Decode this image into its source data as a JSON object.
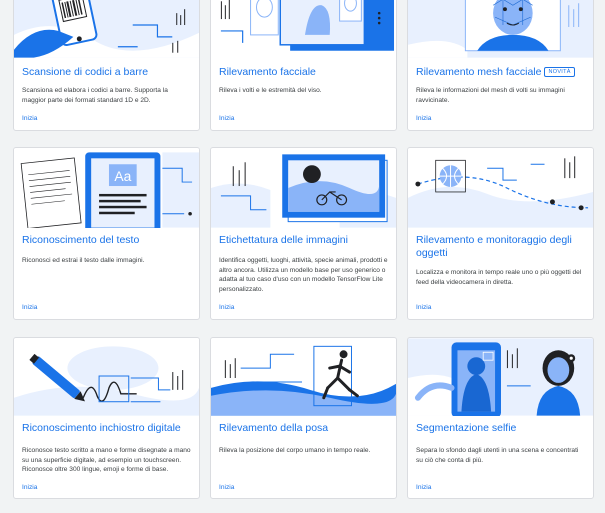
{
  "cards": [
    {
      "title": "Scansione di codici a barre",
      "badge": "",
      "description": "Scansiona ed elabora i codici a barre. Supporta la maggior parte dei formati standard 1D e 2D.",
      "link": "Inizia",
      "illustration": "barcode-illustration"
    },
    {
      "title": "Rilevamento facciale",
      "badge": "",
      "description": "Rileva i volti e le estremità del viso.",
      "link": "Inizia",
      "illustration": "face-detection-illustration"
    },
    {
      "title": "Rilevamento mesh facciale",
      "badge": "NOVITÀ",
      "description": "Rileva le informazioni del mesh di volti su immagini ravvicinate.",
      "link": "Inizia",
      "illustration": "face-mesh-illustration"
    },
    {
      "title": "Riconoscimento del testo",
      "badge": "",
      "description": "Riconosci ed estrai il testo dalle immagini.",
      "link": "Inizia",
      "illustration": "text-recognition-illustration"
    },
    {
      "title": "Etichettatura delle immagini",
      "badge": "",
      "description": "Identifica oggetti, luoghi, attività, specie animali, prodotti e altro ancora. Utilizza un modello base per uso generico o adatta al tuo caso d'uso con un modello TensorFlow Lite personalizzato.",
      "link": "Inizia",
      "illustration": "image-labeling-illustration"
    },
    {
      "title": "Rilevamento e monitoraggio degli oggetti",
      "badge": "",
      "description": "Localizza e monitora in tempo reale uno o più oggetti del feed della videocamera in diretta.",
      "link": "Inizia",
      "illustration": "object-tracking-illustration"
    },
    {
      "title": "Riconoscimento inchiostro digitale",
      "badge": "",
      "description": "Riconosce testo scritto a mano e forme disegnate a mano su una superficie digitale, ad esempio un touchscreen. Riconosce oltre 300 lingue, emoji e forme di base.",
      "link": "Inizia",
      "illustration": "digital-ink-illustration"
    },
    {
      "title": "Rilevamento della posa",
      "badge": "",
      "description": "Rileva la posizione del corpo umano in tempo reale.",
      "link": "Inizia",
      "illustration": "pose-detection-illustration"
    },
    {
      "title": "Segmentazione selfie",
      "badge": "",
      "description": "Separa lo sfondo dagli utenti in una scena e concentrati su ciò che conta di più.",
      "link": "Inizia",
      "illustration": "selfie-segmentation-illustration"
    }
  ],
  "colors": {
    "accent": "#1a73e8",
    "illustration_light": "#e8f0fe",
    "illustration_mid": "#8ab4f8",
    "illustration_dark": "#1967d2"
  }
}
